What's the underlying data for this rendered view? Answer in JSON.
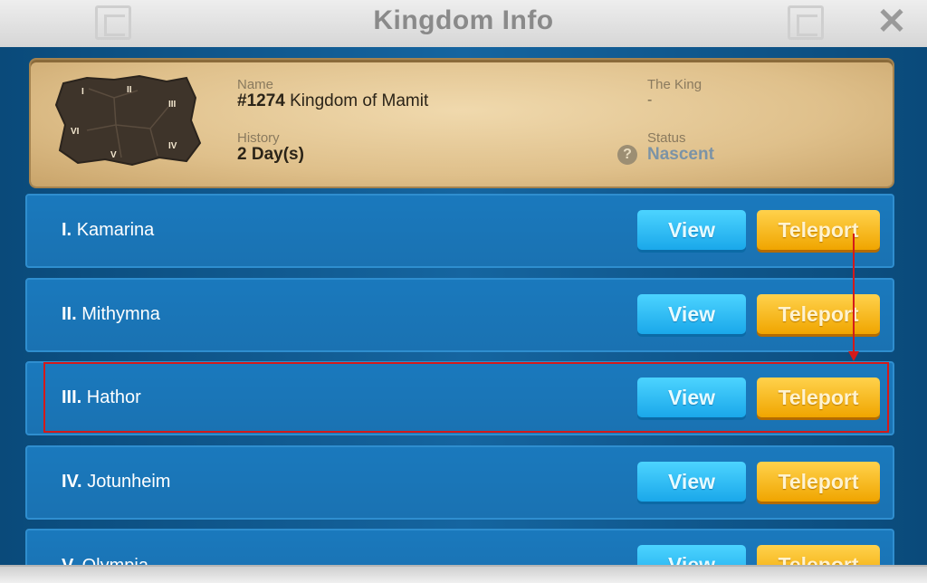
{
  "window": {
    "title": "Kingdom Info",
    "close_glyph": "✕"
  },
  "info": {
    "name_label": "Name",
    "kingdom_number": "#1274",
    "kingdom_name": "Kingdom of Mamit",
    "history_label": "History",
    "history_value": "2 Day(s)",
    "king_label": "The King",
    "king_value": "-",
    "status_label": "Status",
    "status_value": "Nascent",
    "help_glyph": "?",
    "map_zones": [
      "I",
      "II",
      "III",
      "VI",
      "IV",
      "V"
    ]
  },
  "rows": [
    {
      "numeral": "I.",
      "name": "Kamarina",
      "view_label": "View",
      "teleport_label": "Teleport"
    },
    {
      "numeral": "II.",
      "name": "Mithymna",
      "view_label": "View",
      "teleport_label": "Teleport"
    },
    {
      "numeral": "III.",
      "name": "Hathor",
      "view_label": "View",
      "teleport_label": "Teleport"
    },
    {
      "numeral": "IV.",
      "name": "Jotunheim",
      "view_label": "View",
      "teleport_label": "Teleport"
    },
    {
      "numeral": "V.",
      "name": "Olympia",
      "view_label": "View",
      "teleport_label": "Teleport"
    }
  ],
  "colors": {
    "highlight": "#d41a1a",
    "view": "#1aa8ea",
    "teleport": "#f0a500"
  },
  "icons": {
    "close": "close-icon",
    "help": "help-icon",
    "map": "kingdom-map-icon"
  }
}
